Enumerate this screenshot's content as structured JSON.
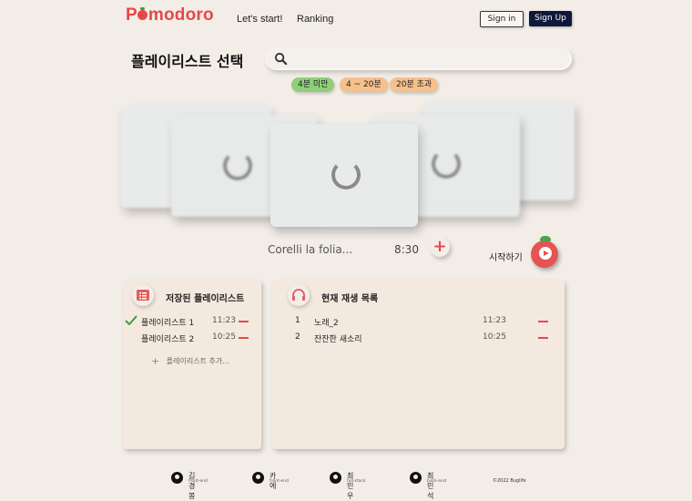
{
  "header": {
    "logo": "Pomodoro",
    "nav": [
      "Let's start!",
      "Ranking"
    ],
    "sign_in": "Sign in",
    "sign_up": "Sign Up"
  },
  "page_title": "플레이리스트 선택",
  "search": {
    "value": "",
    "placeholder": ""
  },
  "filters": [
    {
      "label": "4분 미만",
      "color": "#8fcf7a"
    },
    {
      "label": "4 ~ 20분",
      "color": "#f6c08c"
    },
    {
      "label": "20분 초과",
      "color": "#f6c08c"
    }
  ],
  "now_selected": {
    "title": "Corelli la folia...",
    "duration": "8:30"
  },
  "start_label": "시작하기",
  "saved_panel": {
    "title": "저장된 플레이리스트",
    "items": [
      {
        "name": "플레이리스트 1",
        "time": "11:23",
        "checked": true
      },
      {
        "name": "플레이리스트 2",
        "time": "10:25",
        "checked": false
      }
    ],
    "add_label": "플레이리스트 추가..."
  },
  "queue_panel": {
    "title": "현재 재생 목록",
    "items": [
      {
        "index": "1",
        "name": "노래_2",
        "time": "11:23"
      },
      {
        "index": "2",
        "name": "잔잔한 새소리",
        "time": "10:25"
      }
    ]
  },
  "footer": {
    "members": [
      {
        "name": "김경봉",
        "role": "front-end"
      },
      {
        "name": "카에",
        "role": "front-end"
      },
      {
        "name": "최민우",
        "role": "full-stack"
      },
      {
        "name": "최민석",
        "role": "back-end"
      }
    ],
    "copyright": "©2022 Buglife"
  },
  "colors": {
    "accent": "#e84848",
    "navy": "#10183a",
    "background": "#f3ede8",
    "panel": "#f4e9df"
  }
}
